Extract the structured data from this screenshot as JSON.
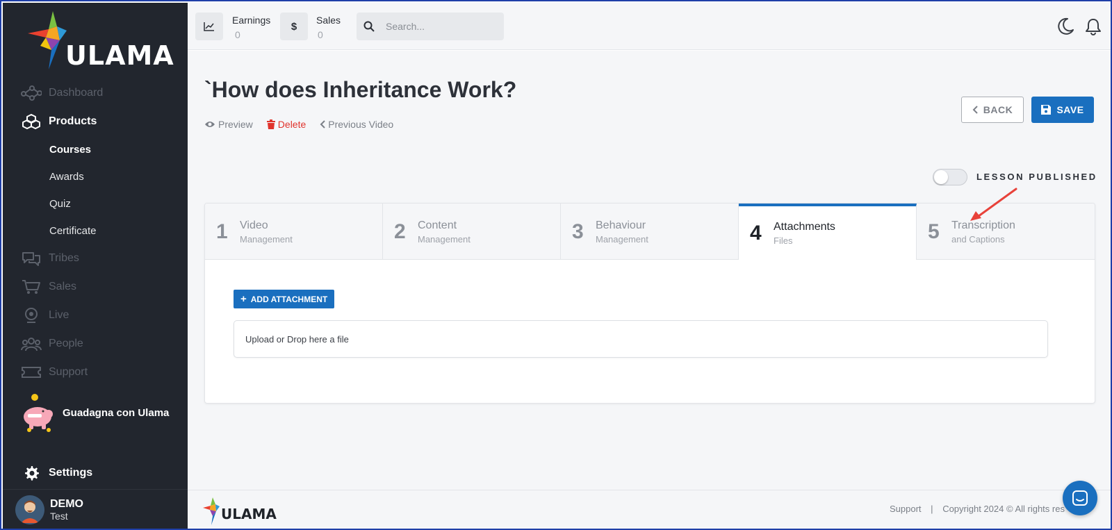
{
  "brand": {
    "name": "ULAMA"
  },
  "sidebar": {
    "items": [
      {
        "label": "Dashboard",
        "icon": "dashboard-network-icon",
        "active": false
      },
      {
        "label": "Products",
        "icon": "cubes-icon",
        "active": true
      },
      {
        "label": "Tribes",
        "icon": "comments-icon",
        "active": false
      },
      {
        "label": "Sales",
        "icon": "cart-icon",
        "active": false
      },
      {
        "label": "Live",
        "icon": "webcam-icon",
        "active": false
      },
      {
        "label": "People",
        "icon": "users-icon",
        "active": false
      },
      {
        "label": "Support",
        "icon": "ticket-icon",
        "active": false
      }
    ],
    "subitems": [
      {
        "label": "Courses",
        "active": true
      },
      {
        "label": "Awards",
        "active": false
      },
      {
        "label": "Quiz",
        "active": false
      },
      {
        "label": "Certificate",
        "active": false
      }
    ],
    "promo": {
      "label": "Guadagna con Ulama",
      "icon": "piggy-bank-icon"
    },
    "settings": {
      "label": "Settings",
      "icon": "gear-icon"
    },
    "user": {
      "name": "DEMO",
      "sub": "Test"
    }
  },
  "topbar": {
    "earnings": {
      "label": "Earnings",
      "value": "0",
      "icon": "chart-line-icon"
    },
    "sales": {
      "label": "Sales",
      "value": "0",
      "icon": "dollar-icon"
    },
    "search": {
      "placeholder": "Search...",
      "value": ""
    },
    "icons": [
      "moon-icon",
      "bell-icon"
    ]
  },
  "page": {
    "title": "`How does Inheritance Work?",
    "actions": [
      {
        "label": "Preview",
        "icon": "eye-icon"
      },
      {
        "label": "Delete",
        "icon": "trash-icon"
      },
      {
        "label": "Previous Video",
        "icon": "chevron-left-icon"
      }
    ],
    "back_label": "BACK",
    "save_label": "SAVE",
    "published_label": "LESSON PUBLISHED",
    "published": false
  },
  "tabs": [
    {
      "num": "1",
      "title": "Video",
      "sub": "Management",
      "active": false
    },
    {
      "num": "2",
      "title": "Content",
      "sub": "Management",
      "active": false
    },
    {
      "num": "3",
      "title": "Behaviour",
      "sub": "Management",
      "active": false
    },
    {
      "num": "4",
      "title": "Attachments",
      "sub": "Files",
      "active": true
    },
    {
      "num": "5",
      "title": "Transcription",
      "sub": "and Captions",
      "active": false
    }
  ],
  "attachments": {
    "add_label": "ADD ATTACHMENT",
    "dropzone_text": "Upload or Drop here a file"
  },
  "footer": {
    "support": "Support",
    "separator": "|",
    "copyright": "Copyright 2024 © All rights res"
  },
  "colors": {
    "accent": "#1a6fbf",
    "sidebar": "#22262e",
    "danger": "#e0332c",
    "annotation": "#e8423a"
  }
}
